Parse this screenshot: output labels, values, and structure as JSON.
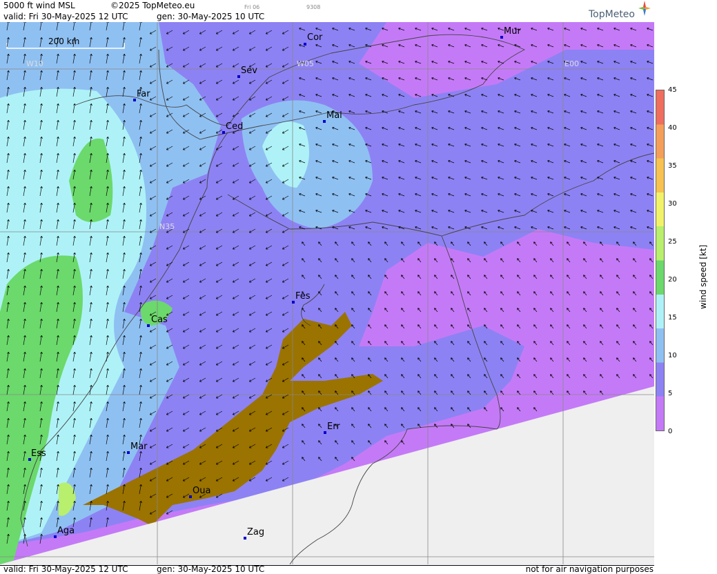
{
  "header": {
    "title": "5000 ft wind MSL",
    "copyright": "©2025 TopMeteo.eu",
    "day_tag": "Fri 06",
    "code": "9308",
    "valid": "valid:  Fri  30-May-2025  12 UTC",
    "generated": "gen:  30-May-2025 10 UTC",
    "logo": "TopMeteo"
  },
  "footer": {
    "valid": "valid:  Fri  30-May-2025  12 UTC",
    "generated": "gen:  30-May-2025 10 UTC",
    "disclaimer": "not for air navigation purposes"
  },
  "scale_bar": "200 km",
  "grid_labels": {
    "w10": "W10",
    "w05": "W05",
    "e00": "E00",
    "n35": "N35"
  },
  "cities": {
    "cor": "Cor",
    "mur": "Mur",
    "sev": "Sev",
    "far": "Far",
    "ced": "Ced",
    "mal": "Mal",
    "fes": "Fes",
    "cas": "Cas",
    "err": "Err",
    "mar": "Mar",
    "ess": "Ess",
    "oua": "Oua",
    "aga": "Aga",
    "zag": "Zag"
  },
  "legend": {
    "label": "wind speed [kt]",
    "ticks": [
      "45",
      "40",
      "35",
      "30",
      "25",
      "20",
      "15",
      "10",
      "5",
      "0"
    ],
    "colors": {
      "c0": "#c47af7",
      "c5": "#8d82f3",
      "c10": "#8fc0f2",
      "c15": "#aef2f7",
      "c20": "#6bd96b",
      "c25": "#b8ef6c",
      "c30": "#f2f26a",
      "c35": "#f7c24f",
      "c40": "#f59e5a",
      "c45": "#ef6e5e"
    },
    "terrain_color": "#9a7300",
    "nodata_color": "#efefef"
  }
}
